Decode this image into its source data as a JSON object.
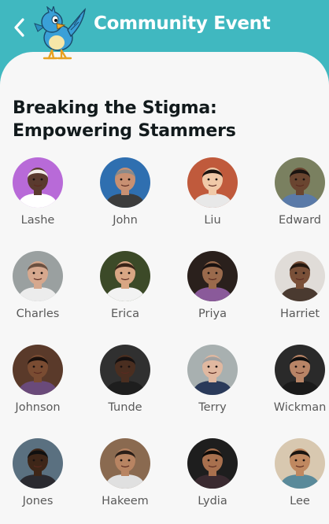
{
  "header": {
    "title": "Community Event"
  },
  "event": {
    "title_line1": "Breaking the Stigma:",
    "title_line2": "Empowering Stammers"
  },
  "attendees": [
    {
      "name": "Lashe",
      "bg": "#b86ad8",
      "skin": "#5a3a2e",
      "hair": "#f2ece8",
      "shirt": "#ffffff"
    },
    {
      "name": "John",
      "bg": "#2f6fb0",
      "skin": "#c89072",
      "hair": "#8a8a8a",
      "shirt": "#3c3c3c"
    },
    {
      "name": "Liu",
      "bg": "#c05a3c",
      "skin": "#f0c9a8",
      "hair": "#1c1410",
      "shirt": "#e8e8e8"
    },
    {
      "name": "Edward",
      "bg": "#7a8060",
      "skin": "#6a4530",
      "hair": "#1a1410",
      "shirt": "#5a7aa8"
    },
    {
      "name": "Charles",
      "bg": "#9aa0a0",
      "skin": "#d6a88e",
      "hair": "#6a5040",
      "shirt": "#ececec"
    },
    {
      "name": "Erica",
      "bg": "#3c4a28",
      "skin": "#d8a684",
      "hair": "#3a2418",
      "shirt": "#f2f2f2"
    },
    {
      "name": "Priya",
      "bg": "#2a201c",
      "skin": "#9a6a4c",
      "hair": "#1a1210",
      "shirt": "#8a5a9a"
    },
    {
      "name": "Harriet",
      "bg": "#e0dcd8",
      "skin": "#7a5038",
      "hair": "#241810",
      "shirt": "#4a3a30"
    },
    {
      "name": "Johnson",
      "bg": "#5a3a2a",
      "skin": "#7a4c32",
      "hair": "#1a100c",
      "shirt": "#6a4a7a"
    },
    {
      "name": "Tunde",
      "bg": "#303030",
      "skin": "#4a2e20",
      "hair": "#141010",
      "shirt": "#1e1e1e"
    },
    {
      "name": "Terry",
      "bg": "#a8b0b0",
      "skin": "#e0b8a0",
      "hair": "#a0a0a0",
      "shirt": "#2a3a5a"
    },
    {
      "name": "Wickman",
      "bg": "#2a2a2a",
      "skin": "#b88466",
      "hair": "#0e0e0e",
      "shirt": "#1a1a1a"
    },
    {
      "name": "Jones",
      "bg": "#5a7080",
      "skin": "#3e2618",
      "hair": "#101010",
      "shirt": "#2a2a30"
    },
    {
      "name": "Hakeem",
      "bg": "#8a6a50",
      "skin": "#b88462",
      "hair": "#2a1e18",
      "shirt": "#e0e0e0"
    },
    {
      "name": "Lydia",
      "bg": "#1e1e1e",
      "skin": "#a8704e",
      "hair": "#0e0a08",
      "shirt": "#3a2a30"
    },
    {
      "name": "Lee",
      "bg": "#d8c8b0",
      "skin": "#c08860",
      "hair": "#1a1410",
      "shirt": "#5a8a9a"
    }
  ],
  "colors": {
    "brand": "#40b8c0",
    "card": "#f7f7f7",
    "heading": "#121a1c",
    "name_text": "#595959"
  },
  "icons": {
    "back": "chevron-left-icon",
    "mascot": "bluebird-mascot"
  }
}
